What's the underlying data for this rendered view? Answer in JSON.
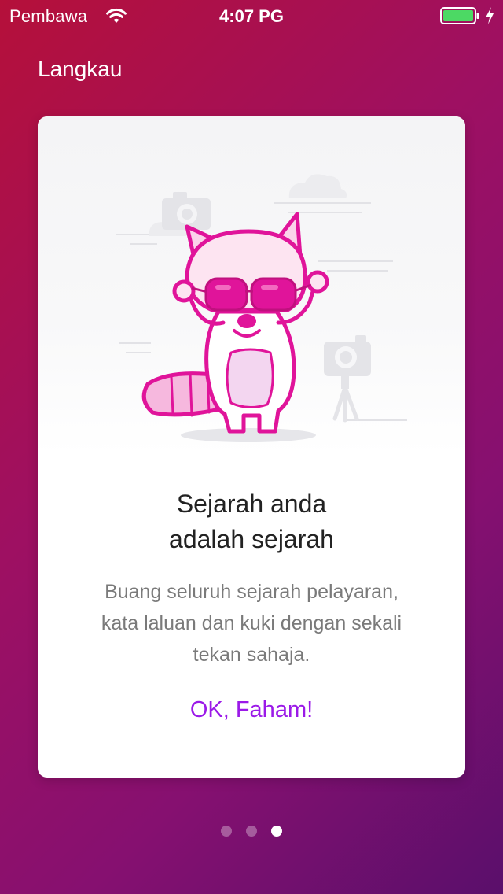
{
  "status_bar": {
    "carrier": "Pembawa",
    "time": "4:07 PG",
    "battery_color": "#4cd964"
  },
  "nav": {
    "skip_label": "Langkau"
  },
  "card": {
    "illustration_icon": "raccoon-with-sunglasses-illustration",
    "title_lines": [
      "Sejarah anda",
      "adalah sejarah"
    ],
    "body_lines": [
      "Buang seluruh sejarah pelayaran,",
      "kata laluan dan kuki dengan sekali",
      "tekan sahaja."
    ],
    "ok_label": "OK, Faham!"
  },
  "pager": {
    "total_pages": 3,
    "current_page": 3
  },
  "colors": {
    "gradient_start": "#b5103a",
    "gradient_end": "#5a0f6b",
    "accent": "#9b19e8",
    "mascot_magenta": "#e0149a"
  }
}
